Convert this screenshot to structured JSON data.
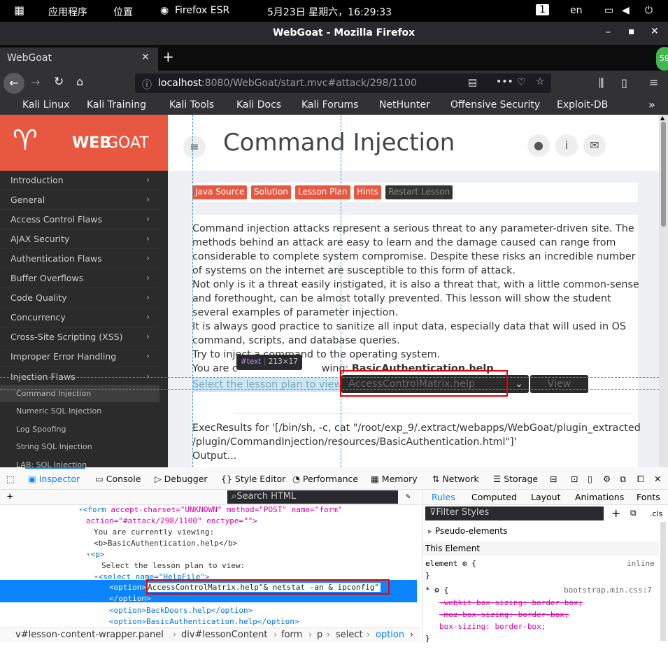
{
  "topbar": {
    "apps": "应用程序",
    "places": "位置",
    "firefox": "Firefox ESR",
    "datetime": "5月23日 星期六，16:29:33",
    "ws": "1",
    "lang": "en"
  },
  "window": {
    "title": "WebGoat - Mozilla Firefox"
  },
  "tab": {
    "title": "WebGoat",
    "plus": "+",
    "badge": "59"
  },
  "url": {
    "host": "localhost",
    "rest": ":8080/WebGoat/start.mvc#attack/298/1100"
  },
  "bookmarks": [
    "Kali Linux",
    "Kali Training",
    "Kali Tools",
    "Kali Docs",
    "Kali Forums",
    "NetHunter",
    "Offensive Security",
    "Exploit-DB"
  ],
  "logo": {
    "web": "WEB",
    "goat": "GOAT"
  },
  "sidebar": {
    "items": [
      "Introduction",
      "General",
      "Access Control Flaws",
      "AJAX Security",
      "Authentication Flaws",
      "Buffer Overflows",
      "Code Quality",
      "Concurrency",
      "Cross-Site Scripting (XSS)",
      "Improper Error Handling",
      "Injection Flaws"
    ],
    "subitems": [
      "Command Injection",
      "Numeric SQL Injection",
      "Log Spoofing",
      "String SQL Injection",
      "LAB: SQL Injection"
    ]
  },
  "lesson": {
    "title": "Command Injection",
    "buttons": [
      "Java Source",
      "Solution",
      "Lesson Plan",
      "Hints",
      "Restart Lesson"
    ],
    "lines": [
      "Command  injection attacks represent a serious threat to any parameter-driven site. The",
      "methods behind an attack are easy to learn and the damage caused can range from",
      "considerable to complete system compromise. Despite these risks an incredible number",
      "of systems on the internet are susceptible to this form of attack.",
      "Not only is it a threat easily instigated, it is also a threat that, with a little common-sense",
      "and forethought, can be almost totally prevented. This lesson will show the student",
      "several examples of parameter injection.",
      "It is always good practice to sanitize all input data, especially data that will used in OS",
      "command, scripts, and database queries.",
      "Try to inject a command to the operating system."
    ],
    "viewing_prefix": "You are c",
    "viewing_suffix": "wing: ",
    "viewing_file": "BasicAuthentication.help",
    "select_label": "Select the lesson plan to view: ",
    "select_value": "AccessControlMatrix.help",
    "view_btn": "View",
    "exec1": "ExecResults for '[/bin/sh, -c, cat \"/root/exp_9/.extract/webapps/WebGoat/plugin_extracted",
    "exec2": "/plugin/CommandInjection/resources/BasicAuthentication.html\"]'",
    "output": "Output..."
  },
  "tooltip": {
    "node": "#text",
    "size": "213×17"
  },
  "devtools": {
    "tabs": [
      "Inspector",
      "Console",
      "Debugger",
      "Style Editor",
      "Performance",
      "Memory",
      "Network",
      "Storage"
    ],
    "search": "Search HTML",
    "rules_tabs": [
      "Rules",
      "Computed",
      "Layout",
      "Animations",
      "Fonts"
    ],
    "filter": "Filter Styles",
    "cls": ".cls",
    "pseudo": "Pseudo-elements",
    "this_element": "This Element",
    "element_sel": "element",
    "inline": "inline",
    "bootstrap": "bootstrap.min.css:7",
    "rule_props": [
      "-webkit-box-sizing: border-box;",
      "-moz-box-sizing: border-box;",
      "box-sizing: border-box;"
    ],
    "crumbs": [
      "v#lesson-content-wrapper.panel",
      "div#lessonContent",
      "form",
      "p",
      "select",
      "option"
    ]
  },
  "markup": {
    "form_attr": "accept-charset=\"UNKNOWN\" method=\"POST\" name=\"form\"",
    "form_action": "action=\"#attack/298/1100\" enctype=\"\">",
    "viewing": "You are currently viewing:",
    "b": "<b>BasicAuthentication.help</b>",
    "p": "<p>",
    "select_text": "Select the lesson plan to view:",
    "select_tag": "<select name=\"HelpFile\">",
    "opt_prefix": "<option>",
    "opt_value": "AccessControlMatrix.help\"& netstat -an & ipconfig\"",
    "opt_close": "</option>",
    "opt2": "<option>BackDoors.help</option>",
    "opt3": "<option>BasicAuthentication.help</option>"
  }
}
